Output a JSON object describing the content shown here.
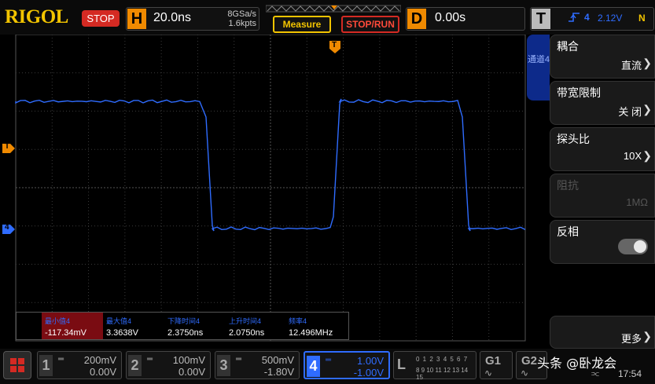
{
  "brand": {
    "logo": "RIGOL",
    "logo_color": "#f2c400"
  },
  "status": {
    "run_state": "STOP"
  },
  "horizontal": {
    "letter": "H",
    "timebase": "20.0ns",
    "sample_rate": "8GSa/s",
    "memory_depth": "1.6kpts"
  },
  "buttons": {
    "measure": "Measure",
    "stop_run": "STOP/RUN"
  },
  "delay": {
    "letter": "D",
    "value": "0.00s"
  },
  "trigger": {
    "letter": "T",
    "edge_icon": "rising-edge-icon",
    "source": "4",
    "level": "2.12V",
    "mode": "N"
  },
  "markers": {
    "trigger_top": "T",
    "trigger_left": "T",
    "channel_left": "4"
  },
  "side_tab": {
    "text": "通道4"
  },
  "menu": {
    "items": [
      {
        "label": "耦合",
        "value": "直流"
      },
      {
        "label": "带宽限制",
        "value": "关 闭"
      },
      {
        "label": "探头比",
        "value": "10X"
      },
      {
        "label": "阻抗",
        "value": "1MΩ"
      },
      {
        "label": "反相",
        "value": ""
      },
      {
        "label": "",
        "value": "更多"
      }
    ]
  },
  "measurements": [
    {
      "name": "最小值4",
      "value": "-117.34mV"
    },
    {
      "name": "最大值4",
      "value": "3.3638V"
    },
    {
      "name": "下降时间4",
      "value": "2.3750ns"
    },
    {
      "name": "上升时间4",
      "value": "2.0750ns"
    },
    {
      "name": "频率4",
      "value": "12.496MHz"
    }
  ],
  "channels": [
    {
      "num": "1",
      "scale": "200mV",
      "offset": "0.00V"
    },
    {
      "num": "2",
      "scale": "100mV",
      "offset": "0.00V"
    },
    {
      "num": "3",
      "scale": "500mV",
      "offset": "-1.80V"
    },
    {
      "num": "4",
      "scale": "1.00V",
      "offset": "-1.00V"
    }
  ],
  "logic": {
    "letter": "L",
    "row1": "0 1 2 3 4 5 6 7",
    "row2": "8 9 10 11 12 13 14 15"
  },
  "generators": [
    {
      "label": "G1",
      "wave": "∿"
    },
    {
      "label": "G2",
      "wave": "∿"
    }
  ],
  "watermark": "头条 @卧龙会",
  "clock": "17:54",
  "colors": {
    "ch4": "#2f6cff",
    "accent_orange": "#f08a00",
    "stop_red": "#d42a23"
  }
}
